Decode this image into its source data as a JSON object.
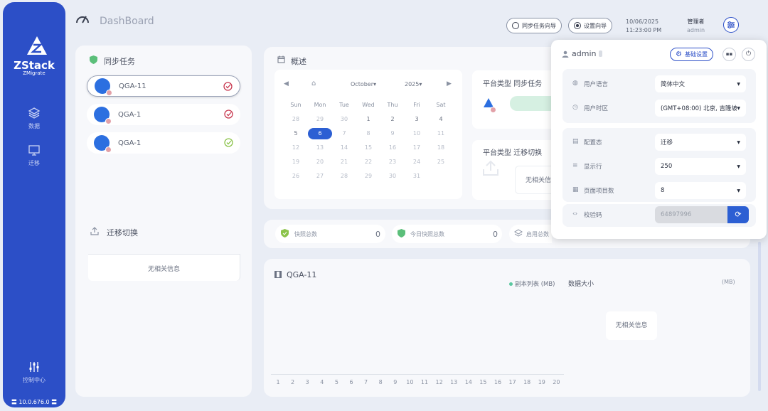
{
  "sidebar": {
    "logo_text": "ZStack",
    "logo_sub": "ZMigrate",
    "items": [
      {
        "label": "数据"
      },
      {
        "label": "迁移"
      },
      {
        "label": "控制中心"
      }
    ],
    "version": "10.0.676.0"
  },
  "topbar": {
    "title": "DashBoard",
    "sync_wizard": "同步任务向导",
    "setup_wizard": "设置向导",
    "date": "10/06/2025",
    "time": "11:23:00 PM",
    "role": "管理者",
    "username": "admin"
  },
  "sync_tasks": {
    "title": "同步任务",
    "items": [
      {
        "name": "QGA-11",
        "status": "error"
      },
      {
        "name": "QGA-1",
        "status": "error"
      },
      {
        "name": "QGA-1",
        "status": "ok"
      }
    ]
  },
  "migration_switch": {
    "title": "迁移切换",
    "empty": "无相关信息"
  },
  "overview": {
    "title": "概述",
    "calendar": {
      "month": "October",
      "year": "2025",
      "weekdays": [
        "Sun",
        "Mon",
        "Tue",
        "Wed",
        "Thu",
        "Fri",
        "Sat"
      ],
      "weeks": [
        [
          "28",
          "29",
          "30",
          "1",
          "2",
          "3",
          "4"
        ],
        [
          "5",
          "6",
          "7",
          "8",
          "9",
          "10",
          "11"
        ],
        [
          "12",
          "13",
          "14",
          "15",
          "16",
          "17",
          "18"
        ],
        [
          "19",
          "20",
          "21",
          "22",
          "23",
          "24",
          "25"
        ],
        [
          "26",
          "27",
          "28",
          "29",
          "30",
          "31",
          ""
        ]
      ],
      "today": "6"
    },
    "platform_sync": "平台类型 同步任务",
    "platform_migrate": "平台类型 迁移切换",
    "migrate_empty": "无相关信息"
  },
  "stats": [
    {
      "label": "快照总数",
      "value": "0"
    },
    {
      "label": "今日快照总数",
      "value": "0"
    },
    {
      "label": "启用总数",
      "value": ""
    }
  ],
  "chart_panel": {
    "title": "QGA-11",
    "legend_series": "副本列表 (MB)",
    "legend_size": "数据大小",
    "unit_right": "(MB)",
    "empty": "无相关信息",
    "x_ticks": [
      "1",
      "2",
      "3",
      "4",
      "5",
      "6",
      "7",
      "8",
      "9",
      "10",
      "11",
      "12",
      "13",
      "14",
      "15",
      "16",
      "17",
      "18",
      "19",
      "20"
    ]
  },
  "popup": {
    "user": "admin",
    "basic_settings": "基础设置",
    "rows": [
      {
        "label": "用户语言",
        "value": "简体中文",
        "icon": "globe-icon"
      },
      {
        "label": "用户时区",
        "value": "(GMT+08:00) 北京, 吉隆坡",
        "icon": "clock-icon"
      },
      {
        "label": "配置态",
        "value": "迁移",
        "icon": "doc-icon"
      },
      {
        "label": "显示行",
        "value": "250",
        "icon": "rows-icon"
      },
      {
        "label": "页面项目数",
        "value": "8",
        "icon": "list-icon"
      }
    ],
    "code_label": "校验码",
    "code_value": "64897996"
  },
  "colors": {
    "primary": "#2c4fc7",
    "accent": "#2c5fd3",
    "error": "#c8384f",
    "ok": "#8bc34a"
  }
}
